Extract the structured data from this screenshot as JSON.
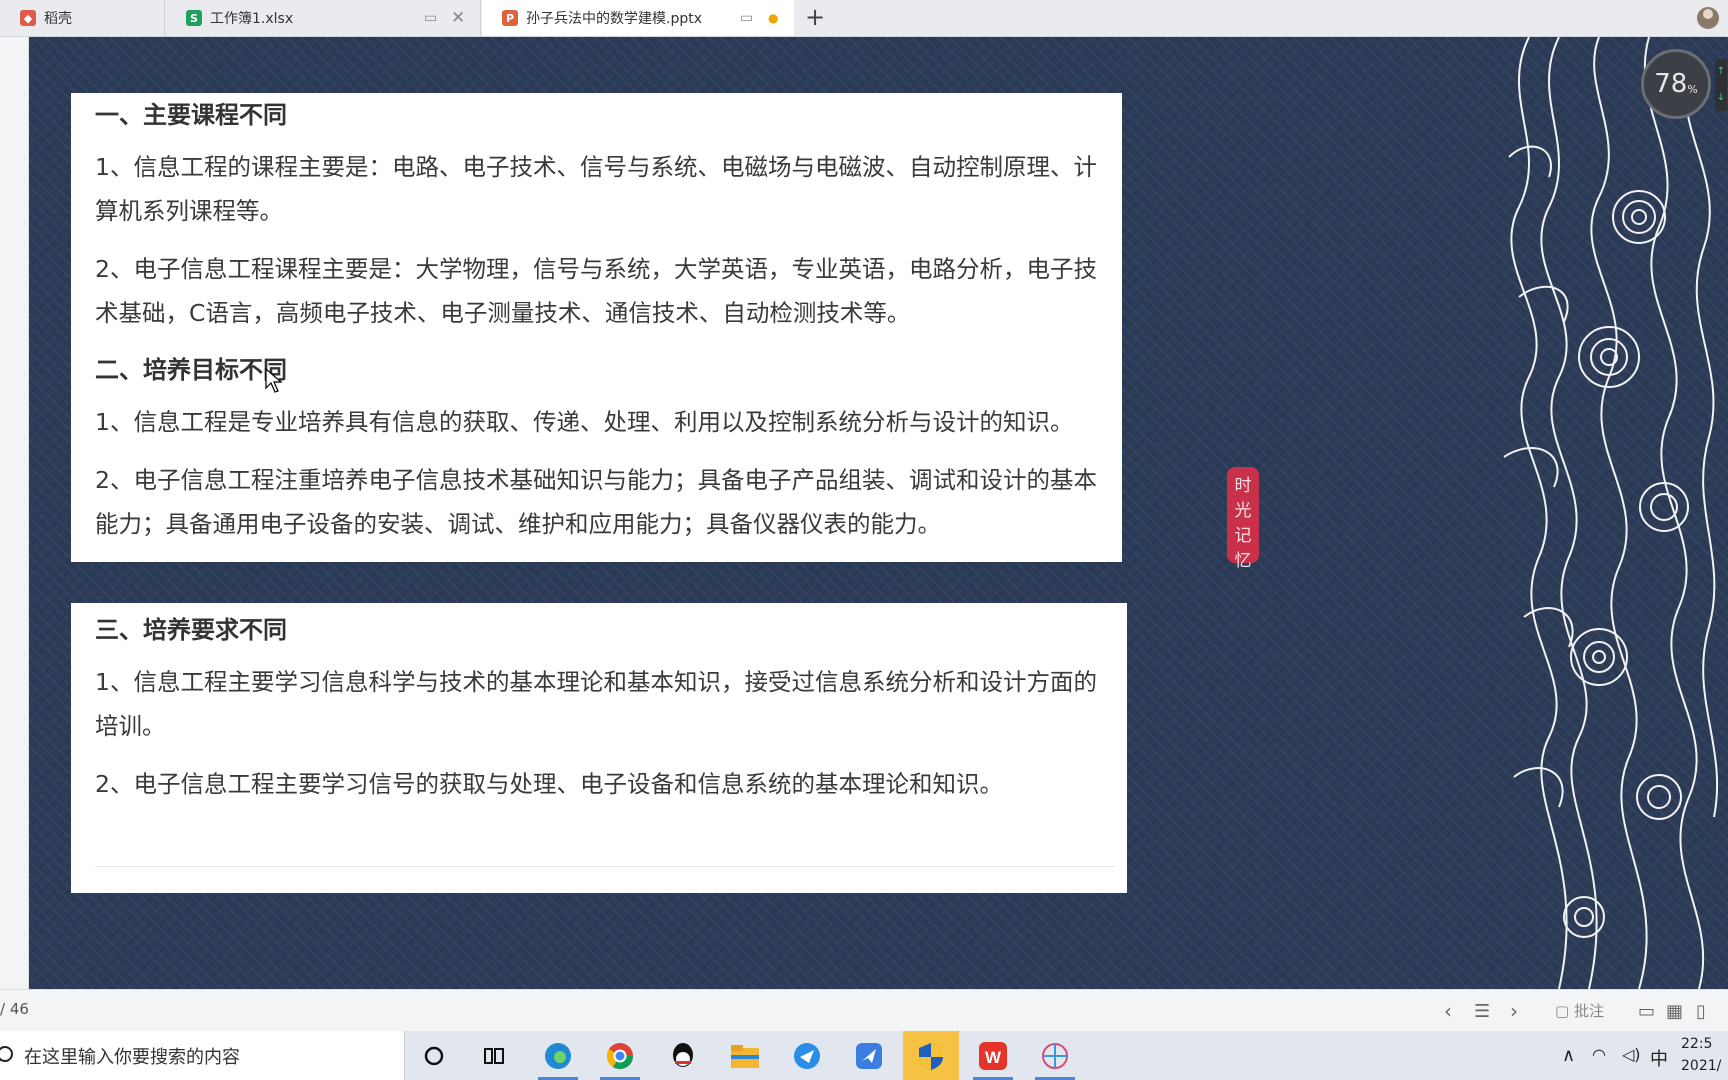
{
  "tabs": [
    {
      "label": "稻壳",
      "icon": "docer-icon",
      "color": "#e05b4b"
    },
    {
      "label": "工作簿1.xlsx",
      "icon": "spreadsheet-icon",
      "color": "#20a162"
    },
    {
      "label": "孙子兵法中的数学建模.pptx",
      "icon": "presentation-icon",
      "color": "#e0623f"
    }
  ],
  "card1": {
    "h1": "一、主要课程不同",
    "p1": "1、信息工程的课程主要是：电路、电子技术、信号与系统、电磁场与电磁波、自动控制原理、计算机系列课程等。",
    "p2": "2、电子信息工程课程主要是：大学物理，信号与系统，大学英语，专业英语，电路分析，电子技术基础，C语言，高频电子技术、电子测量技术、通信技术、自动检测技术等。",
    "h2": "二、培养目标不同",
    "p3": "1、信息工程是专业培养具有信息的获取、传递、处理、利用以及控制系统分析与设计的知识。",
    "p4": "2、电子信息工程注重培养电子信息技术基础知识与能力；具备电子产品组装、调试和设计的基本能力；具备通用电子设备的安装、调试、维护和应用能力；具备仪器仪表的能力。"
  },
  "card2": {
    "h3": "三、培养要求不同",
    "p5": "1、信息工程主要学习信息科学与技术的基本理论和基本知识，接受过信息系统分析和设计方面的培训。",
    "p6": "2、电子信息工程主要学习信号的获取与处理、电子设备和信息系统的基本理论和知识。"
  },
  "seal": {
    "chars": [
      "时",
      "光",
      "记",
      "忆"
    ]
  },
  "meter": {
    "value": "78",
    "unit": "%"
  },
  "statusbar": {
    "page": "/ 46",
    "comment": "批注"
  },
  "taskbar": {
    "search_placeholder": "在这里输入你要搜索的内容",
    "ime": "中",
    "time": "22:5",
    "date": "2021/"
  },
  "colors": {
    "slide_bg": "#2c3b57",
    "seal": "#c9314a",
    "active_taskbar": "#f6c243"
  }
}
